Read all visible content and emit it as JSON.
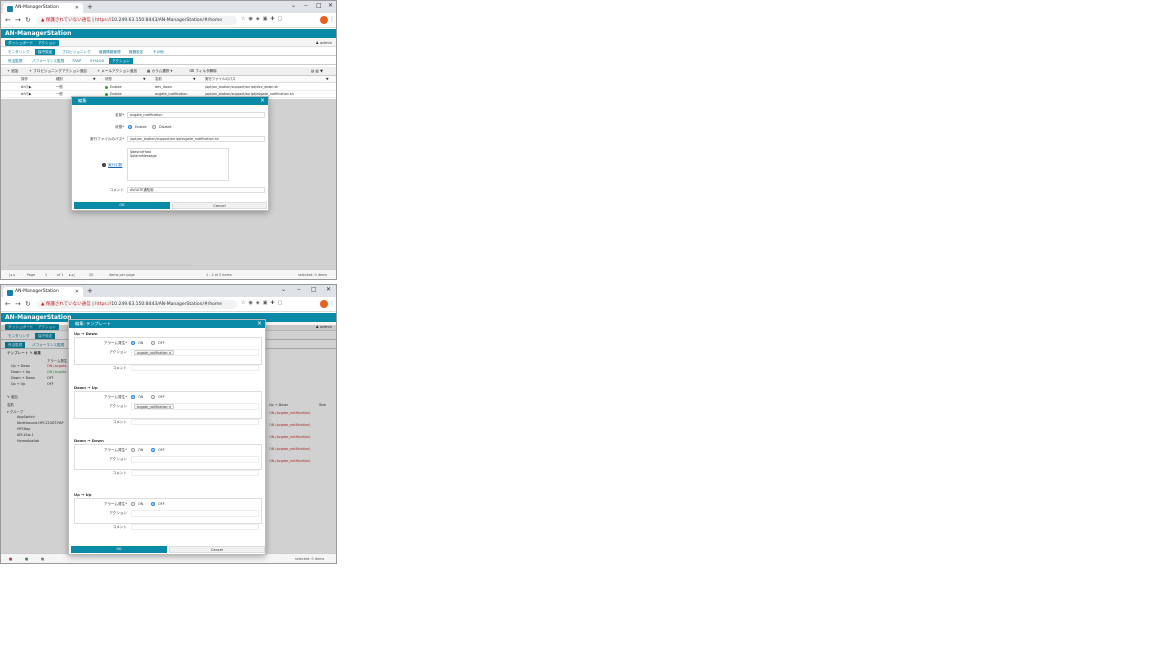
{
  "browser": {
    "tab_title": "AN-ManagerStation",
    "new_tab": "+",
    "warning": "保護されていない通信",
    "url_https": "https://",
    "url_rest": "10.249.63.150:8443/AN-ManagerStation/#/home",
    "min": "‒",
    "max": "□",
    "close": "✕"
  },
  "app": {
    "title": "AN-ManagerStation",
    "chip_dashboard": "ダッシュボード",
    "chip_actions": "アクション",
    "user": "admin"
  },
  "menu": [
    "モニタリング",
    "保守設定",
    "プロビジョニング",
    "機器情報管理",
    "機器設定",
    "その他"
  ],
  "submenu": [
    "死活監視",
    "パフォーマンス監視",
    "TRAP",
    "SYSLOG",
    "アクション"
  ],
  "toolbar1": {
    "add": "追加",
    "prov_add": "プロビジョニングアクション追加",
    "mail_add": "メールアクション追加",
    "col_select": "カラム選択",
    "filter_clear": "フィルタ解除"
  },
  "table1": {
    "headers": [
      "操作",
      "種別",
      "状態",
      "名前",
      "実行ファイルのパス"
    ],
    "rows": [
      {
        "kind": "一般",
        "status": "Enable",
        "name": "dev_down",
        "path": "/opt/an_station/support/script/dev_down.sh"
      },
      {
        "kind": "一般",
        "status": "Enable",
        "name": "avgate_notification",
        "path": "/opt/an_station/support/script/avgate_notification.sh"
      }
    ]
  },
  "footer1": {
    "page": "Page",
    "page_num": "1",
    "of": "of 1",
    "per_page": "20",
    "items_per_page": "items per page",
    "range": "1 - 2 of 2 items",
    "selected": "selected: 0 items"
  },
  "dialog1": {
    "title": "編集",
    "name_label": "名前*",
    "name_value": "avgate_notification",
    "status_label": "状態*",
    "enable": "Enable",
    "disable": "Disable",
    "path_label": "実行ファイルのパス*",
    "path_value": "/opt/an_station/support/script/avgate_notification.sh",
    "args_label": "実行引数",
    "args_value_1": "$deviceHost",
    "args_value_2": "$alarmMessage",
    "comment_label": "コメント",
    "comment_value": "AVGATE通知用",
    "ok": "OK",
    "cancel": "Cancel"
  },
  "window2": {
    "toolbar_template": "テンプレート",
    "toolbar_edit": "編集",
    "side_header": "アラーム発生",
    "side_rows": [
      {
        "label": "Up → Down",
        "val": "ON (avgate..."
      },
      {
        "label": "Down → Up",
        "val": "ON (avgate..."
      },
      {
        "label": "Down → Down",
        "val": "OFF"
      },
      {
        "label": "Up → Up",
        "val": "OFF"
      }
    ],
    "tree_add": "追加",
    "tree_header": "名前",
    "tree_root": "グループ",
    "tree_items": [
      "AppSwitch",
      "Northbound-HPC120DT-PAP",
      "HPC6ap",
      "APL1Sw-1",
      "HomeAvailab"
    ],
    "right_header1": "Up → Down",
    "right_header2": "Stat",
    "right_rows": [
      "ON (avgate_notification)",
      "ON (avgate_notification)",
      "ON (avgate_notification)",
      "ON (avgate_notification)",
      "ON (avgate_notification)"
    ],
    "footer_red": "0",
    "footer_green": "8",
    "footer_gray": "0",
    "footer_selected": "selected: 0 items"
  },
  "dialog2": {
    "title": "編集: テンプレート",
    "alarm_label": "アラーム発生*",
    "action_label": "アクション",
    "comment_label": "コメント",
    "on": "ON",
    "off": "OFF",
    "sections": [
      {
        "title": "Up → Down",
        "on": true,
        "action": "avgate_notification"
      },
      {
        "title": "Down → Up",
        "on": true,
        "action": "avgate_notification"
      },
      {
        "title": "Down → Down",
        "on": false,
        "action": ""
      },
      {
        "title": "Up → Up",
        "on": false,
        "action": ""
      }
    ],
    "ok": "OK",
    "cancel": "Cancel"
  },
  "colors": {
    "accent": "#0b8aa8",
    "radio": "#1e88e5"
  }
}
